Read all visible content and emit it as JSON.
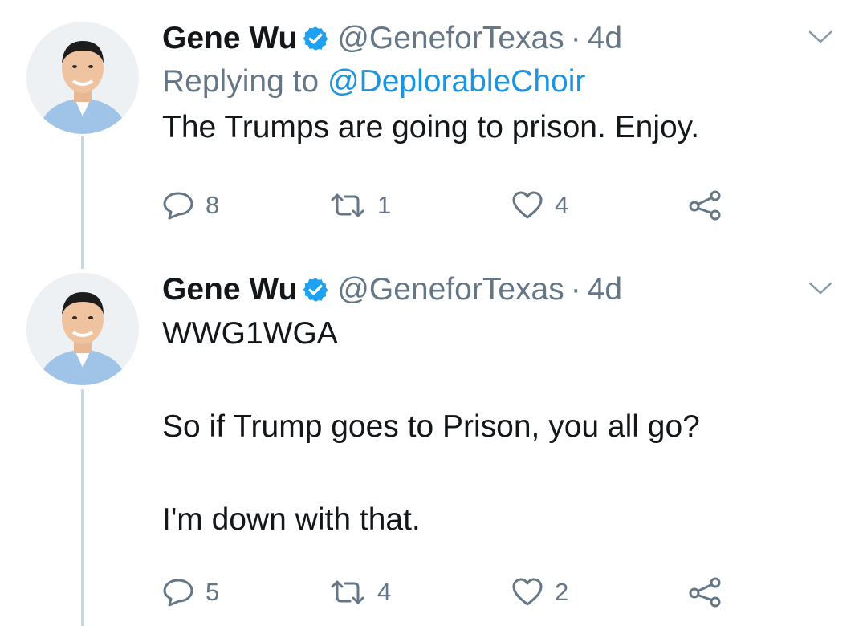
{
  "tweets": [
    {
      "name": "Gene Wu",
      "handle": "@GeneforTexas",
      "separator": "·",
      "time": "4d",
      "replying_prefix": "Replying to",
      "replying_to": "@DeplorableChoir",
      "text": "The Trumps are going to prison. Enjoy.",
      "replies": "8",
      "retweets": "1",
      "likes": "4"
    },
    {
      "name": "Gene Wu",
      "handle": "@GeneforTexas",
      "separator": "·",
      "time": "4d",
      "text": "WWG1WGA\n\nSo if Trump goes to Prison, you all go?\n\nI'm down with that.",
      "replies": "5",
      "retweets": "4",
      "likes": "2"
    }
  ],
  "colors": {
    "name": "#14171a",
    "secondary": "#657786",
    "link": "#1b95e0",
    "verified": "#1da1f2",
    "thread_line": "#ccd6dd"
  },
  "icons": [
    "reply-icon",
    "retweet-icon",
    "like-icon",
    "share-icon",
    "verified-icon",
    "chevron-down-icon"
  ]
}
